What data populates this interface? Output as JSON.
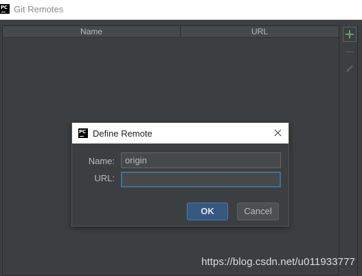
{
  "window": {
    "title": "Git Remotes",
    "icon": "pycharm-icon"
  },
  "table": {
    "columns": [
      "Name",
      "URL"
    ],
    "rows": []
  },
  "toolbar": {
    "add": "add-icon",
    "remove": "remove-icon",
    "edit": "edit-icon",
    "add_color": "#59a869"
  },
  "dialog": {
    "title": "Define Remote",
    "name_label": "Name:",
    "name_value": "origin",
    "url_label": "URL:",
    "url_value": "",
    "ok_label": "OK",
    "cancel_label": "Cancel",
    "accent": "#365880"
  },
  "watermark": "https://blog.csdn.net/u011933777"
}
